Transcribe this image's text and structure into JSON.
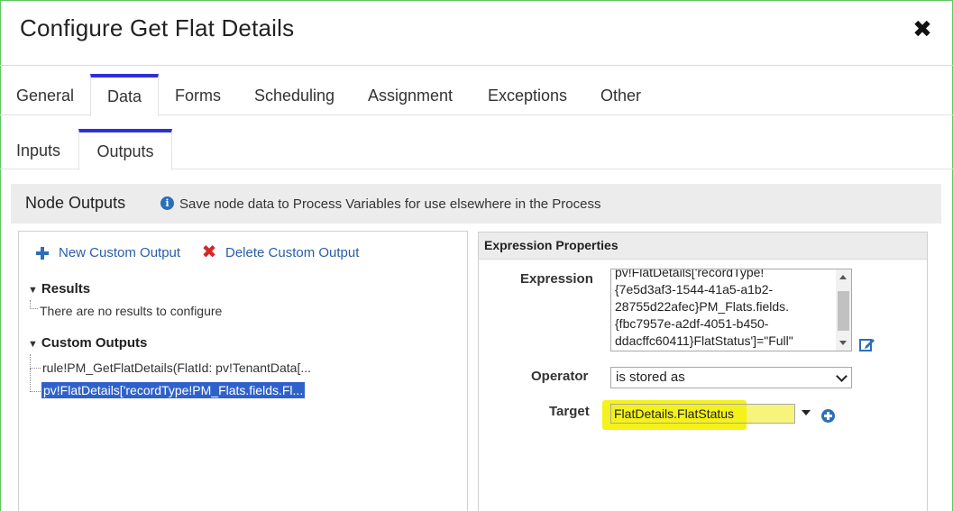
{
  "dialog": {
    "title": "Configure Get Flat Details",
    "close_icon": "close-icon"
  },
  "tabs": [
    {
      "label": "General"
    },
    {
      "label": "Data",
      "active": true
    },
    {
      "label": "Forms"
    },
    {
      "label": "Scheduling"
    },
    {
      "label": "Assignment"
    },
    {
      "label": "Exceptions"
    },
    {
      "label": "Other"
    }
  ],
  "subtabs": [
    {
      "label": "Inputs"
    },
    {
      "label": "Outputs",
      "active": true
    }
  ],
  "node_outputs": {
    "title": "Node Outputs",
    "description": "Save node data to Process Variables for use elsewhere in the Process"
  },
  "left_panel": {
    "new_output": "New Custom Output",
    "delete_output": "Delete Custom Output",
    "results_header": "Results",
    "results_empty": "There are no results to configure",
    "custom_header": "Custom Outputs",
    "custom_items": [
      "rule!PM_GetFlatDetails(FlatId: pv!TenantData[...",
      "pv!FlatDetails['recordType!PM_Flats.fields.Fl..."
    ]
  },
  "expression_properties": {
    "title": "Expression Properties",
    "expression_label": "Expression",
    "expression_value": "pv!FlatDetails['recordType!\n{7e5d3af3-1544-41a5-a1b2-\n28755d22afec}PM_Flats.fields.\n{fbc7957e-a2df-4051-b450-\nddacffc60411}FlatStatus']=\"Full\"",
    "operator_label": "Operator",
    "operator_value": "is stored as",
    "target_label": "Target",
    "target_value": "FlatDetails.FlatStatus"
  },
  "colors": {
    "accent": "#2f2fd6",
    "link": "#2b5ea7",
    "delete": "#d7262b",
    "highlight": "#f4f21a",
    "selection": "#2f62c9"
  }
}
